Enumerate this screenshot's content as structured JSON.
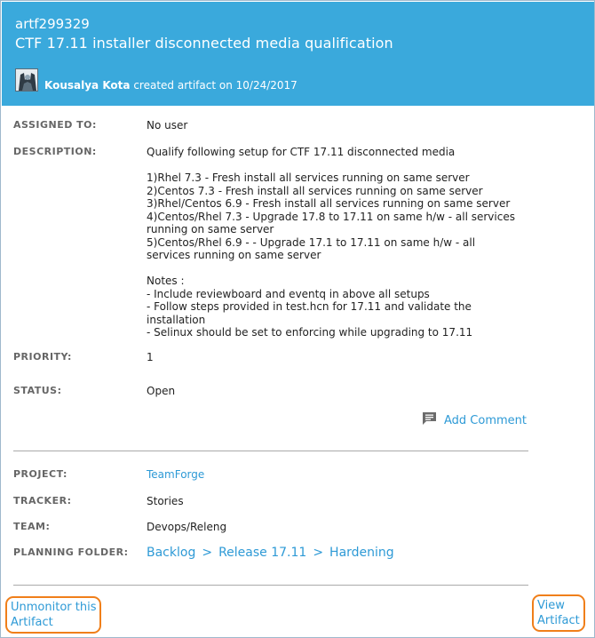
{
  "header": {
    "artifact_id": "artf299329",
    "title": "CTF 17.11 installer disconnected media qualification",
    "creator_name": "Kousalya Kota",
    "created_text": "created artifact on 10/24/2017",
    "avatar_icon": "user-avatar-icon"
  },
  "fields": {
    "assigned_to_label": "ASSIGNED TO:",
    "assigned_to_value": "No user",
    "description_label": "DESCRIPTION:",
    "description_lines": [
      "Qualify following setup for CTF 17.11 disconnected media",
      "",
      "1)Rhel 7.3 - Fresh install all services running on same server",
      "2)Centos 7.3 - Fresh install all services running on same server",
      "3)Rhel/Centos 6.9  - Fresh install all services running on same server",
      "4)Centos/Rhel 7.3 - Upgrade 17.8 to 17.11 on same h/w - all services",
      "running on same server",
      "5)Centos/Rhel 6.9 - - Upgrade 17.1 to 17.11 on same h/w - all",
      "services running on same server",
      "",
      "Notes :",
      "- Include reviewboard and eventq in above all setups",
      "- Follow steps provided in test.hcn for 17.11 and validate the",
      "installation",
      "- Selinux should be set to enforcing while upgrading to 17.11"
    ],
    "priority_label": "PRIORITY:",
    "priority_value": "1",
    "status_label": "STATUS:",
    "status_value": "Open"
  },
  "add_comment": {
    "label": "Add Comment",
    "icon": "comment-icon"
  },
  "details": {
    "project_label": "PROJECT:",
    "project_value": "TeamForge",
    "tracker_label": "TRACKER:",
    "tracker_value": "Stories",
    "team_label": "TEAM:",
    "team_value": "Devops/Releng",
    "planning_folder_label": "PLANNING FOLDER:",
    "planning_folder_path": [
      "Backlog",
      "Release 17.11",
      "Hardening"
    ],
    "path_separator": ">"
  },
  "footer": {
    "unmonitor_line1": "Unmonitor this",
    "unmonitor_line2": "Artifact",
    "view_line1": "View",
    "view_line2": "Artifact"
  },
  "colors": {
    "header_bg": "#3aa9dc",
    "link": "#2e9ad6",
    "highlight_border": "#f07f1a"
  }
}
